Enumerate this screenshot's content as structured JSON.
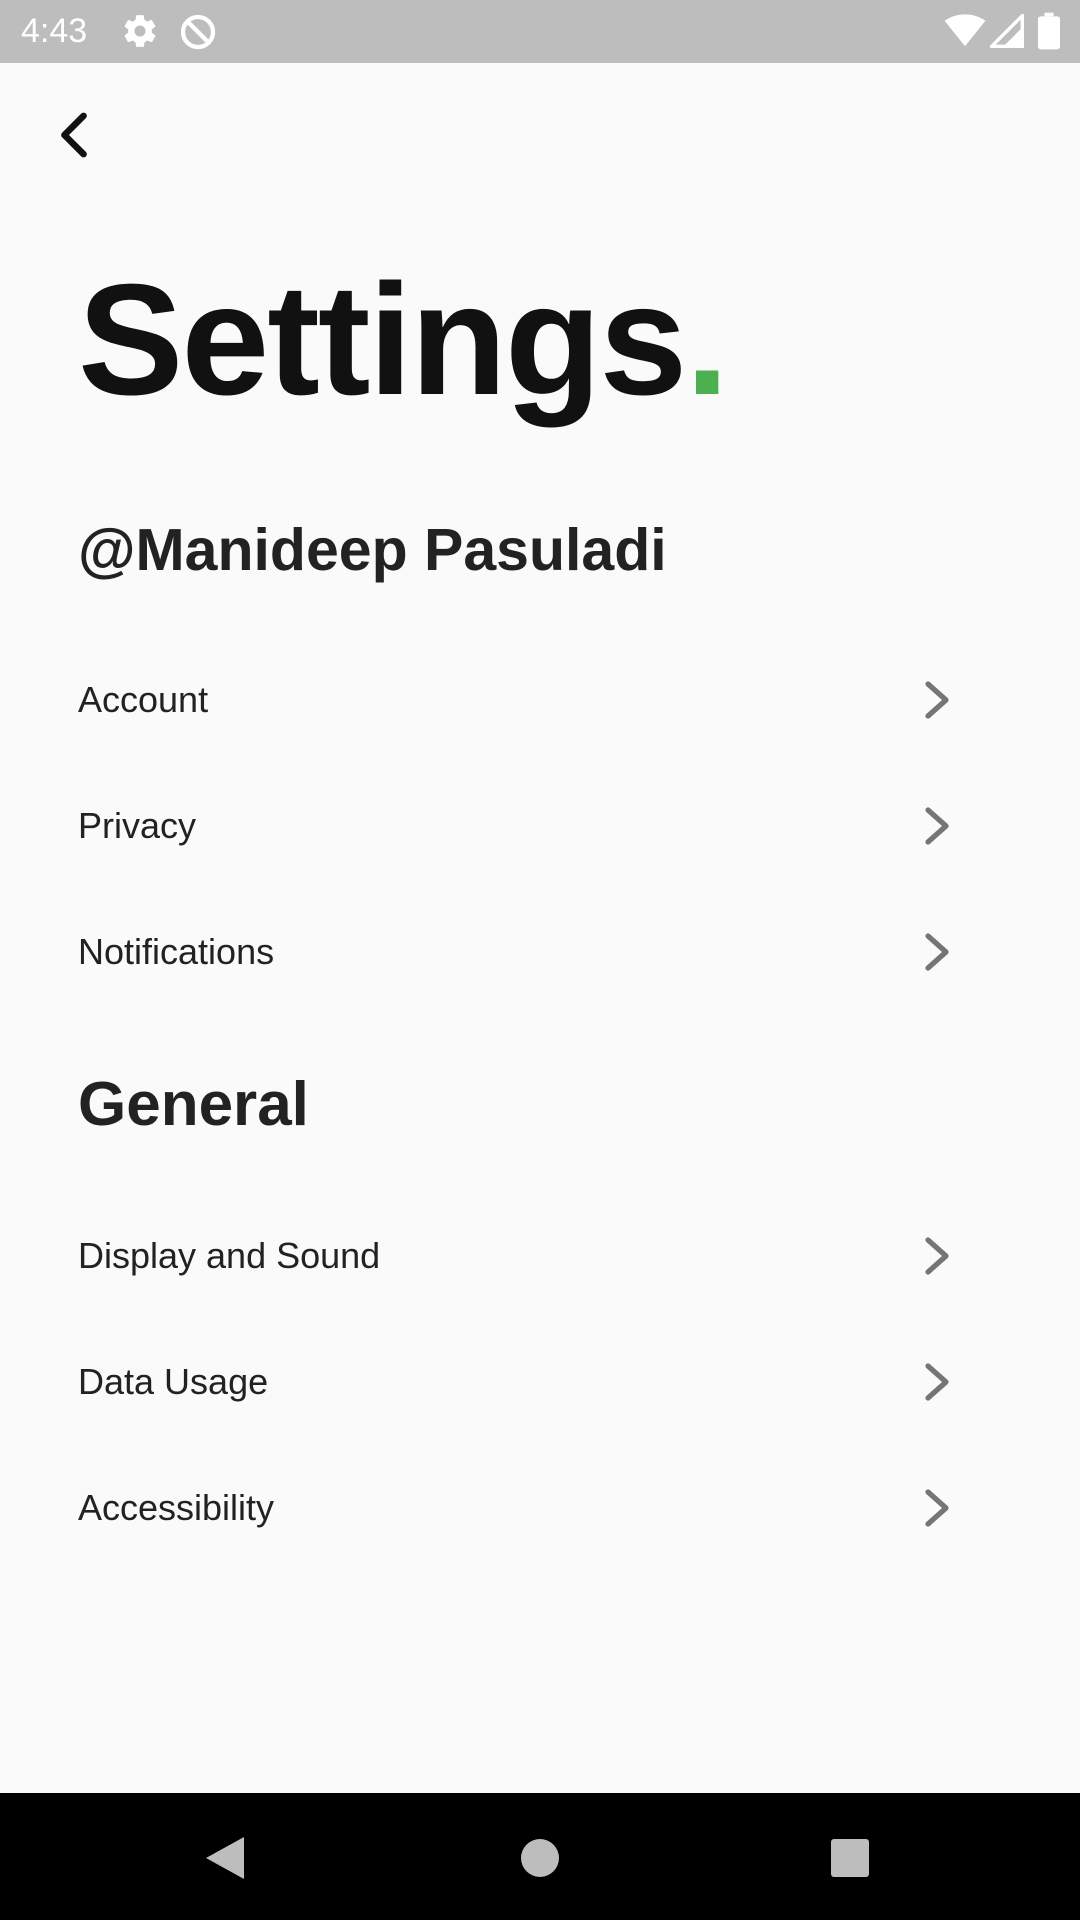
{
  "status_bar": {
    "time": "4:43",
    "icons": [
      "gear-icon",
      "data-saver-icon",
      "wifi-icon",
      "signal-icon",
      "battery-icon"
    ]
  },
  "header": {
    "back_icon": "back-arrow-icon",
    "title": "Settings",
    "title_dot": ".",
    "title_dot_color": "#4caf50"
  },
  "profile": {
    "username": "@Manideep Pasuladi"
  },
  "account_section": {
    "items": [
      {
        "label": "Account"
      },
      {
        "label": "Privacy"
      },
      {
        "label": "Notifications"
      }
    ]
  },
  "general_section": {
    "heading": "General",
    "items": [
      {
        "label": "Display and Sound"
      },
      {
        "label": "Data Usage"
      },
      {
        "label": "Accessibility"
      }
    ]
  },
  "nav_bar": {
    "buttons": [
      "back-triangle-icon",
      "home-circle-icon",
      "recents-square-icon"
    ]
  }
}
